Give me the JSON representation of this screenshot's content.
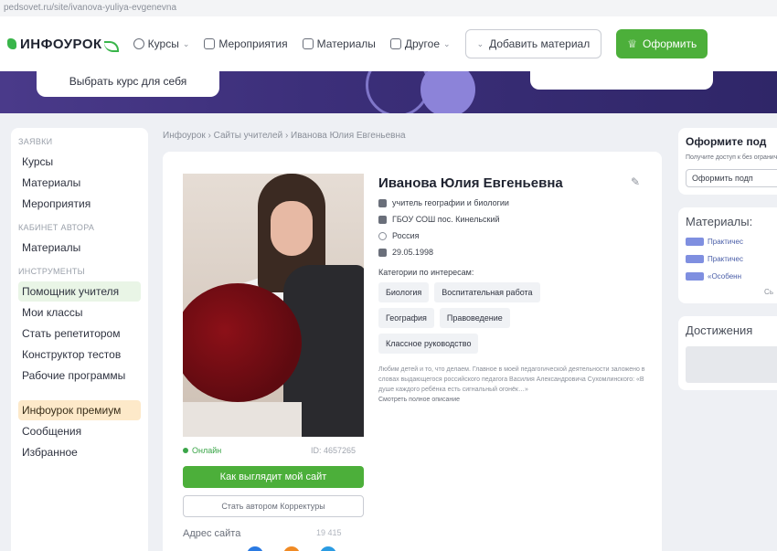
{
  "browser": {
    "url": "pedsovet.ru/site/ivanova-yuliya-evgenevna"
  },
  "topnav": {
    "logo": "ИНФОУРОК",
    "items": [
      {
        "label": "Курсы",
        "icon": "course-icon",
        "dropdown": true
      },
      {
        "label": "Мероприятия",
        "icon": "calendar-icon",
        "dropdown": false
      },
      {
        "label": "Материалы",
        "icon": "document-icon",
        "dropdown": false
      },
      {
        "label": "Другое",
        "icon": "grid-icon",
        "dropdown": true
      }
    ],
    "add_material": "Добавить материал",
    "subscribe": "Оформить"
  },
  "banner": {
    "button": "Выбрать курс для себя"
  },
  "sidebar": {
    "sections": [
      {
        "title": "ЗАЯВКИ",
        "items": [
          "Курсы",
          "Материалы",
          "Мероприятия"
        ]
      },
      {
        "title": "КАБИНЕТ АВТОРА",
        "items": [
          "Материалы"
        ]
      },
      {
        "title": "ИНСТРУМЕНТЫ",
        "items": [
          "Помощник учителя",
          "Мои классы",
          "Стать репетитором",
          "Конструктор тестов",
          "Рабочие программы"
        ]
      }
    ],
    "premium": "Инфоурок премиум",
    "extra": [
      "Сообщения",
      "Избранное"
    ]
  },
  "breadcrumb": "Инфоурок › Сайты учителей › Иванова Юлия Евгеньевна",
  "profile": {
    "name": "Иванова Юлия Евгеньевна",
    "position": "учитель географии и биологии",
    "school": "ГБОУ СОШ пос. Кинельский",
    "country": "Россия",
    "birthdate": "29.05.1998",
    "categories_label": "Категории по интересам:",
    "tags": [
      "Биология",
      "Воспитательная работа",
      "География",
      "Правоведение",
      "Классное руководство"
    ],
    "about": "Любим детей и то, что делаем. Главное в моей педагогической деятельности заложено в словах выдающегося российского педагога Василия Александровича Сухомлинского: «В душе каждого ребёнка есть сигнальный огонёк…»",
    "about_more": "Смотреть полное описание",
    "status": "Онлайн",
    "user_id": "ID: 4657265",
    "site_button": "Как выглядит мой сайт",
    "link_button": "Стать автором Корректуры",
    "site_address": "Адрес сайта",
    "site_count": "19 415"
  },
  "right": {
    "promo_title": "Оформите под",
    "promo_text": "Получите доступ к без ограничений",
    "promo_button": "Оформить подп",
    "materials_title": "Материалы:",
    "materials": [
      "Практичес",
      "Практичес",
      "«Особенн"
    ],
    "materials_more": "Сь",
    "achievements_title": "Достижения"
  },
  "colors": {
    "accent": "#4caf3a",
    "banner": "#3c2f7a",
    "premium": "#fde9c9"
  }
}
